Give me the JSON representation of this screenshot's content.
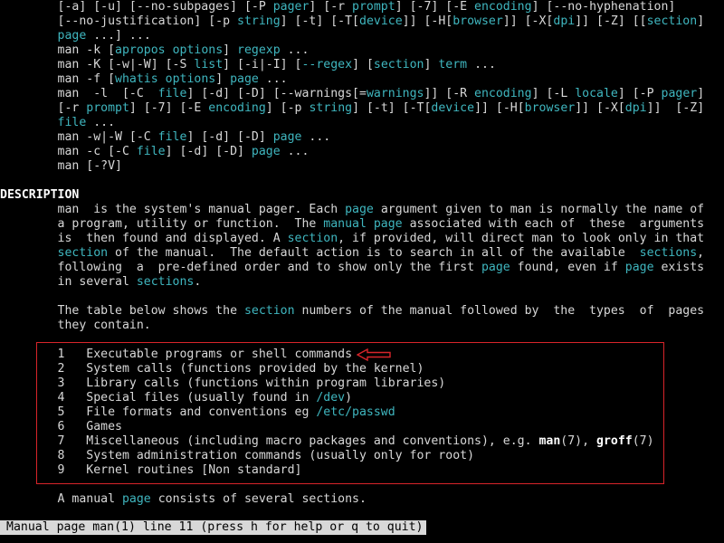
{
  "terminal": {
    "lines": [
      [
        {
          "t": "        [-a] [-u] [--no-subpages] [-P "
        },
        {
          "t": "pager",
          "c": "cyan"
        },
        {
          "t": "] [-r "
        },
        {
          "t": "prompt",
          "c": "cyan"
        },
        {
          "t": "] [-7] [-E "
        },
        {
          "t": "encoding",
          "c": "cyan"
        },
        {
          "t": "] [--no-hyphenation]"
        }
      ],
      [
        {
          "t": "        [--no-justification] [-p "
        },
        {
          "t": "string",
          "c": "cyan"
        },
        {
          "t": "] [-t] [-T["
        },
        {
          "t": "device",
          "c": "cyan"
        },
        {
          "t": "]] [-H["
        },
        {
          "t": "browser",
          "c": "cyan"
        },
        {
          "t": "]] [-X["
        },
        {
          "t": "dpi",
          "c": "cyan"
        },
        {
          "t": "]] [-Z] [["
        },
        {
          "t": "section",
          "c": "cyan"
        },
        {
          "t": "]"
        }
      ],
      [
        {
          "t": "        "
        },
        {
          "t": "page",
          "c": "cyan"
        },
        {
          "t": " ...] ..."
        }
      ],
      [
        {
          "t": "        man -k ["
        },
        {
          "t": "apropos options",
          "c": "cyan"
        },
        {
          "t": "] "
        },
        {
          "t": "regexp",
          "c": "cyan"
        },
        {
          "t": " ..."
        }
      ],
      [
        {
          "t": "        man -K [-w|-W] [-S "
        },
        {
          "t": "list",
          "c": "cyan"
        },
        {
          "t": "] [-i|-I] ["
        },
        {
          "t": "--regex",
          "c": "cyan"
        },
        {
          "t": "] ["
        },
        {
          "t": "section",
          "c": "cyan"
        },
        {
          "t": "] "
        },
        {
          "t": "term",
          "c": "cyan"
        },
        {
          "t": " ..."
        }
      ],
      [
        {
          "t": "        man -f ["
        },
        {
          "t": "whatis options",
          "c": "cyan"
        },
        {
          "t": "] "
        },
        {
          "t": "page",
          "c": "cyan"
        },
        {
          "t": " ..."
        }
      ],
      [
        {
          "t": "        man  -l  [-C  "
        },
        {
          "t": "file",
          "c": "cyan"
        },
        {
          "t": "] [-d] [-D] [--warnings[="
        },
        {
          "t": "warnings",
          "c": "cyan"
        },
        {
          "t": "]] [-R "
        },
        {
          "t": "encoding",
          "c": "cyan"
        },
        {
          "t": "] [-L "
        },
        {
          "t": "locale",
          "c": "cyan"
        },
        {
          "t": "] [-P "
        },
        {
          "t": "pager",
          "c": "cyan"
        },
        {
          "t": "]"
        }
      ],
      [
        {
          "t": "        [-r "
        },
        {
          "t": "prompt",
          "c": "cyan"
        },
        {
          "t": "] [-7] [-E "
        },
        {
          "t": "encoding",
          "c": "cyan"
        },
        {
          "t": "] [-p "
        },
        {
          "t": "string",
          "c": "cyan"
        },
        {
          "t": "] [-t] [-T["
        },
        {
          "t": "device",
          "c": "cyan"
        },
        {
          "t": "]] [-H["
        },
        {
          "t": "browser",
          "c": "cyan"
        },
        {
          "t": "]] [-X["
        },
        {
          "t": "dpi",
          "c": "cyan"
        },
        {
          "t": "]]  [-Z]"
        }
      ],
      [
        {
          "t": "        "
        },
        {
          "t": "file",
          "c": "cyan"
        },
        {
          "t": " ..."
        }
      ],
      [
        {
          "t": "        man -w|-W [-C "
        },
        {
          "t": "file",
          "c": "cyan"
        },
        {
          "t": "] [-d] [-D] "
        },
        {
          "t": "page",
          "c": "cyan"
        },
        {
          "t": " ..."
        }
      ],
      [
        {
          "t": "        man -c [-C "
        },
        {
          "t": "file",
          "c": "cyan"
        },
        {
          "t": "] [-d] [-D] "
        },
        {
          "t": "page",
          "c": "cyan"
        },
        {
          "t": " ..."
        }
      ],
      [
        {
          "t": "        man [-?V]"
        }
      ],
      [],
      [
        {
          "t": "DESCRIPTION",
          "c": "bold"
        }
      ],
      [
        {
          "t": "        man  is the system's manual pager. Each "
        },
        {
          "t": "page",
          "c": "cyan"
        },
        {
          "t": " argument given to man is normally the name of"
        }
      ],
      [
        {
          "t": "        a program, utility or function.  The "
        },
        {
          "t": "manual page",
          "c": "cyan"
        },
        {
          "t": " associated with each of  these  arguments"
        }
      ],
      [
        {
          "t": "        is  then found and displayed. A "
        },
        {
          "t": "section",
          "c": "cyan"
        },
        {
          "t": ", if provided, will direct man to look only in that"
        }
      ],
      [
        {
          "t": "        "
        },
        {
          "t": "section",
          "c": "cyan"
        },
        {
          "t": " of the manual.  The default action is to search in all of the available  "
        },
        {
          "t": "sections",
          "c": "cyan"
        },
        {
          "t": ","
        }
      ],
      [
        {
          "t": "        following  a  pre-defined order and to show only the first "
        },
        {
          "t": "page",
          "c": "cyan"
        },
        {
          "t": " found, even if "
        },
        {
          "t": "page",
          "c": "cyan"
        },
        {
          "t": " exists"
        }
      ],
      [
        {
          "t": "        in several "
        },
        {
          "t": "sections",
          "c": "cyan"
        },
        {
          "t": "."
        }
      ],
      [],
      [
        {
          "t": "        The table below shows the "
        },
        {
          "t": "section",
          "c": "cyan"
        },
        {
          "t": " numbers of the manual followed by  the  types  of  pages"
        }
      ],
      [
        {
          "t": "        they contain."
        }
      ],
      [],
      [
        {
          "t": "        1   Executable programs or shell commands"
        }
      ],
      [
        {
          "t": "        2   System calls (functions provided by the kernel)"
        }
      ],
      [
        {
          "t": "        3   Library calls (functions within program libraries)"
        }
      ],
      [
        {
          "t": "        4   Special files (usually found in "
        },
        {
          "t": "/dev",
          "c": "cyan"
        },
        {
          "t": ")"
        }
      ],
      [
        {
          "t": "        5   File formats and conventions eg "
        },
        {
          "t": "/etc/passwd",
          "c": "cyan"
        }
      ],
      [
        {
          "t": "        6   Games"
        }
      ],
      [
        {
          "t": "        7   Miscellaneous (including macro packages and conventions), e.g. "
        },
        {
          "t": "man",
          "c": "bold"
        },
        {
          "t": "(7), "
        },
        {
          "t": "groff",
          "c": "bold"
        },
        {
          "t": "(7)"
        }
      ],
      [
        {
          "t": "        8   System administration commands (usually only for root)"
        }
      ],
      [
        {
          "t": "        9   Kernel routines [Non standard]"
        }
      ],
      [],
      [
        {
          "t": "        A manual "
        },
        {
          "t": "page",
          "c": "cyan"
        },
        {
          "t": " consists of several sections."
        }
      ]
    ]
  },
  "status_bar": {
    "text": "Manual page man(1) line 11 (press h for help or q to quit)"
  },
  "annotations": {
    "box_color": "#d8242a",
    "arrow_color": "#d8242a"
  },
  "colors": {
    "background": "#000000",
    "text": "#d8d8d8",
    "highlight": "#3fb6bf"
  }
}
